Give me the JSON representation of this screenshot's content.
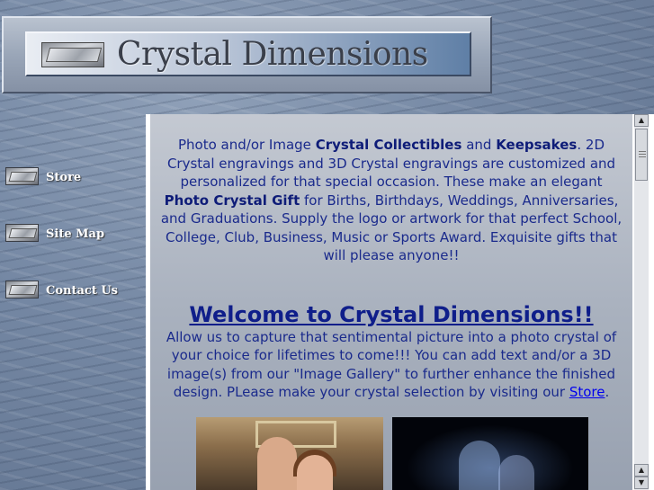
{
  "banner": {
    "title": "Crystal Dimensions"
  },
  "nav": {
    "items": [
      {
        "label": "Store"
      },
      {
        "label": "Site Map"
      },
      {
        "label": "Contact Us"
      }
    ]
  },
  "content": {
    "intro": {
      "t1": "Photo and/or Image ",
      "b1": "Crystal Collectibles",
      "t2": " and ",
      "b2": "Keepsakes",
      "t3": ". 2D Crystal engravings and 3D Crystal engravings are customized and personalized for that special occasion. These make an elegant ",
      "b3": "Photo Crystal Gift",
      "t4": " for Births, Birthdays, Weddings, Anniversaries, and Graduations. Supply the logo or artwork for that perfect School, College, Club, Business, Music or Sports Award. Exquisite gifts that will please anyone!!"
    },
    "welcome": "Welcome to Crystal Dimensions!!",
    "para": "Allow us to capture that sentimental picture into a photo crystal of your choice for lifetimes to come!!! You can add text and/or a 3D image(s) from our \"Image Gallery\" to further enhance the finished design. PLease make your crystal selection by visiting our ",
    "store_link": "Store",
    "para_end": "."
  },
  "scrollbar": {
    "up": "▲",
    "down": "▼"
  }
}
